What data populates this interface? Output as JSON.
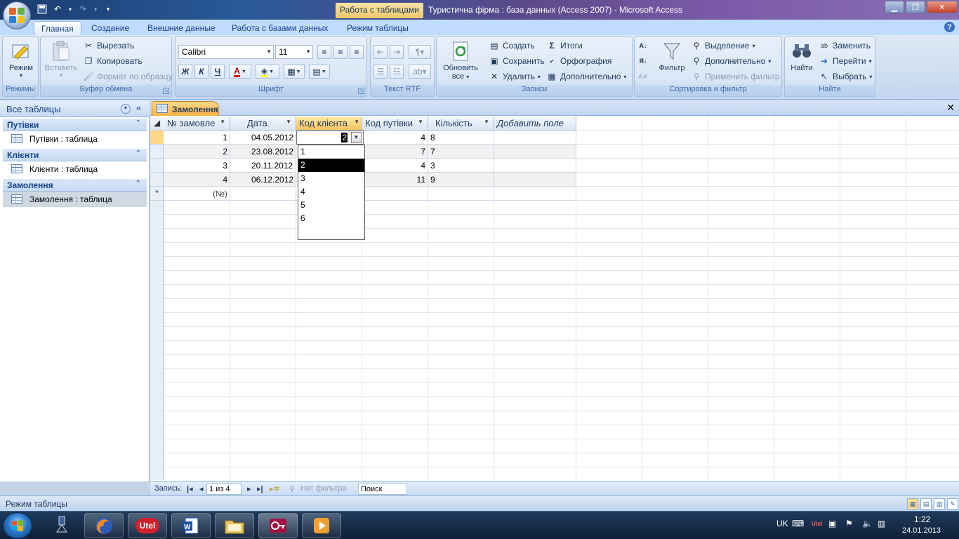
{
  "window": {
    "title": "Туристична фірма : база данных (Access 2007) - Microsoft Access",
    "context_tab_title": "Работа с таблицами",
    "controls": [
      "minimize",
      "maximize",
      "close"
    ]
  },
  "ribbon_tabs": [
    "Главная",
    "Создание",
    "Внешние данные",
    "Работа с базами данных",
    "Режим таблицы"
  ],
  "ribbon": {
    "modes": {
      "mode_label": "Режим",
      "group_label": "Режимы"
    },
    "clipboard": {
      "paste": "Вставить",
      "cut": "Вырезать",
      "copy": "Копировать",
      "format_painter": "Формат по образцу",
      "group_label": "Буфер обмена"
    },
    "font": {
      "font_name": "Calibri",
      "font_size": "11",
      "bold": "Ж",
      "italic": "К",
      "underline": "Ч",
      "font_color_letter": "A",
      "group_label": "Шрифт"
    },
    "rich_text": {
      "group_label": "Текст RTF"
    },
    "records": {
      "refresh_line1": "Обновить",
      "refresh_line2": "все",
      "new": "Создать",
      "save": "Сохранить",
      "delete": "Удалить",
      "totals": "Итоги",
      "spelling": "Орфография",
      "more": "Дополнительно",
      "group_label": "Записи"
    },
    "sort_filter": {
      "filter": "Фильтр",
      "selection": "Выделение",
      "advanced": "Дополнительно",
      "toggle_filter": "Применить фильтр",
      "group_label": "Сортировка и фильтр"
    },
    "find": {
      "find": "Найти",
      "replace": "Заменить",
      "goto": "Перейти",
      "select": "Выбрать",
      "group_label": "Найти"
    }
  },
  "nav_pane": {
    "title": "Все таблицы",
    "groups": [
      {
        "label": "Путівки",
        "item": "Путівки : таблица"
      },
      {
        "label": "Клієнти",
        "item": "Клієнти : таблица"
      },
      {
        "label": "Замолення",
        "item": "Замолення : таблица"
      }
    ]
  },
  "document": {
    "tab_label": "Замолення",
    "columns": [
      "№ замовле",
      "Дата",
      "Код клієнта",
      "Код путівки",
      "Кількість",
      "Добавить поле"
    ],
    "rows": [
      [
        "1",
        "04.05.2012",
        "2",
        "4",
        "8"
      ],
      [
        "2",
        "23.08.2012",
        "",
        "7",
        "7"
      ],
      [
        "3",
        "20.11.2012",
        "",
        "4",
        "3"
      ],
      [
        "4",
        "06.12.2012",
        "",
        "11",
        "9"
      ]
    ],
    "new_row_marker": "*",
    "new_row_id": "(№)",
    "dropdown": {
      "current": "2",
      "options": [
        "1",
        "2",
        "3",
        "4",
        "5",
        "6"
      ],
      "selected": "2"
    }
  },
  "record_nav": {
    "label": "Запись:",
    "position": "1 из 4",
    "filter_status": "Нет фильтра",
    "search_placeholder": "Поиск"
  },
  "status_bar": {
    "text": "Режим таблицы"
  },
  "taskbar": {
    "apps": [
      "Firefox",
      "Utel",
      "Word",
      "Explorer",
      "Access",
      "Media Player"
    ],
    "tray": {
      "lang": "UK",
      "time": "1:22",
      "date": "24.01.2013"
    }
  }
}
